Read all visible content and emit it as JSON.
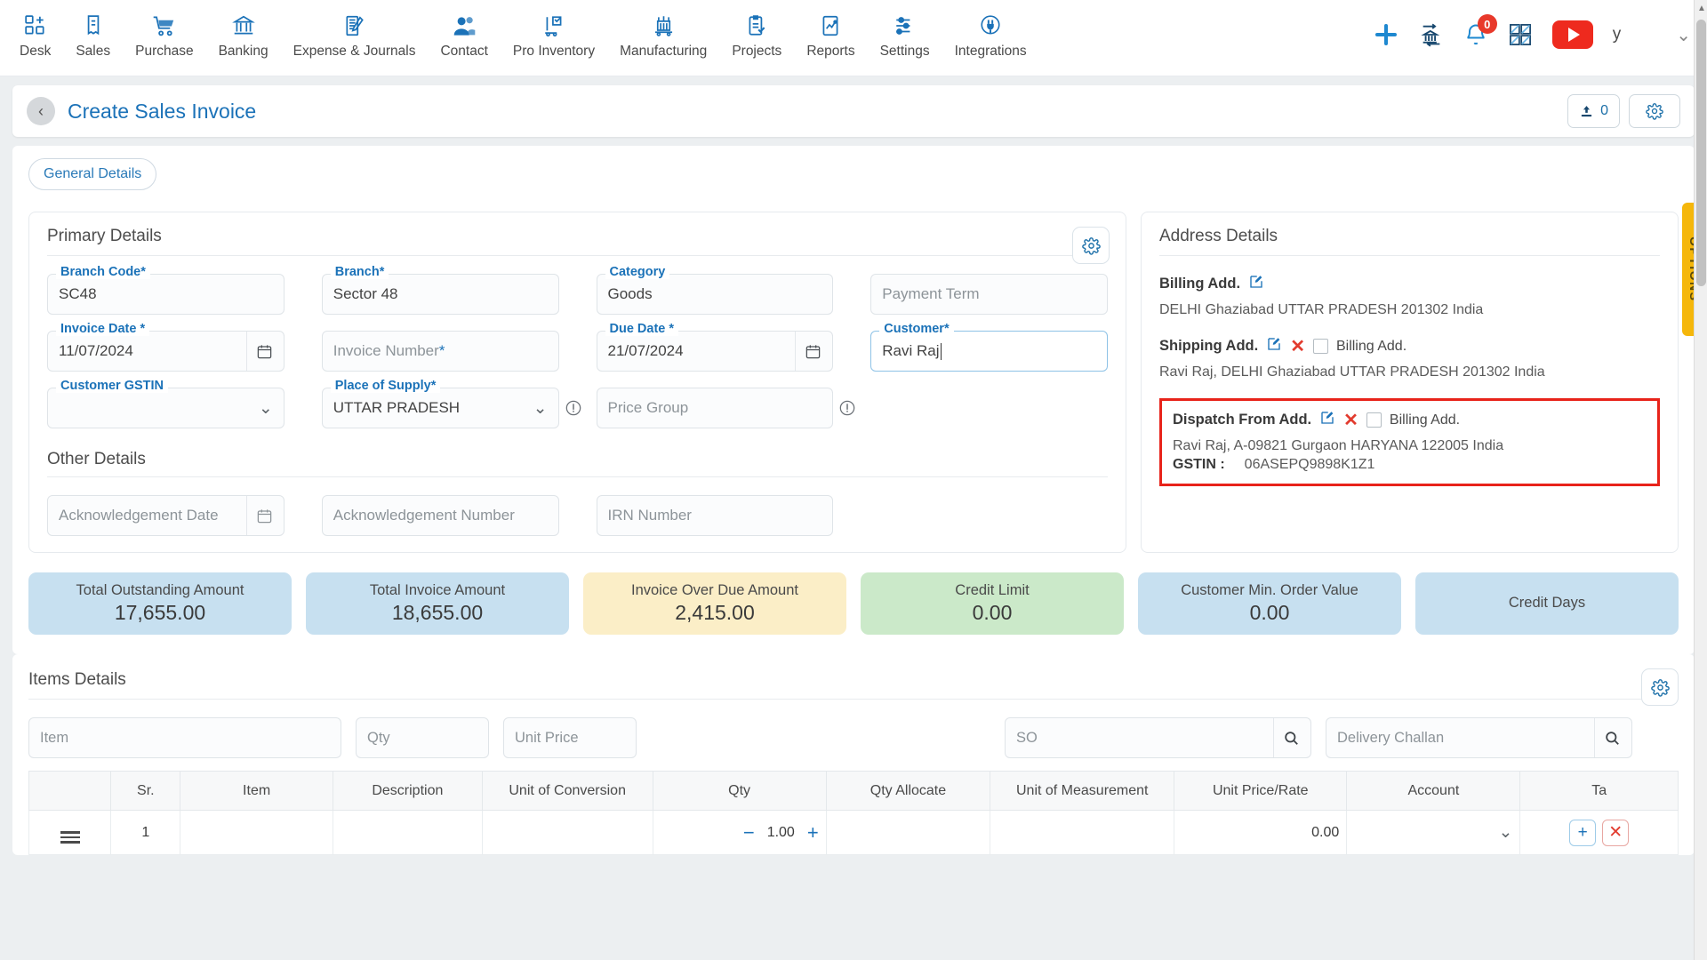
{
  "topnav": {
    "items": [
      {
        "label": "Desk",
        "icon": "desk-icon"
      },
      {
        "label": "Sales",
        "icon": "sales-icon"
      },
      {
        "label": "Purchase",
        "icon": "purchase-cart-icon"
      },
      {
        "label": "Banking",
        "icon": "bank-icon"
      },
      {
        "label": "Expense & Journals",
        "icon": "journal-icon"
      },
      {
        "label": "Contact",
        "icon": "contact-people-icon"
      },
      {
        "label": "Pro Inventory",
        "icon": "inventory-icon"
      },
      {
        "label": "Manufacturing",
        "icon": "manufacturing-icon"
      },
      {
        "label": "Projects",
        "icon": "projects-clipboard-icon"
      },
      {
        "label": "Reports",
        "icon": "reports-chart-icon"
      },
      {
        "label": "Settings",
        "icon": "settings-sliders-icon"
      },
      {
        "label": "Integrations",
        "icon": "integrations-plug-icon"
      }
    ],
    "notification_count": "0",
    "user_initial": "y"
  },
  "header": {
    "title": "Create Sales Invoice",
    "upload_count": "0"
  },
  "tabs": [
    {
      "label": "General Details"
    }
  ],
  "options_tab": {
    "label": "OPTIONS"
  },
  "primary_details": {
    "heading": "Primary Details",
    "fields": {
      "branch_code": {
        "label": "Branch Code",
        "required": true,
        "value": "SC48"
      },
      "branch": {
        "label": "Branch",
        "required": true,
        "value": "Sector 48"
      },
      "category": {
        "label": "Category",
        "required": false,
        "value": "Goods"
      },
      "payment_term": {
        "label": "",
        "placeholder": "Payment Term",
        "value": ""
      },
      "invoice_date": {
        "label": "Invoice Date *",
        "value": "11/07/2024"
      },
      "invoice_number": {
        "label": "",
        "placeholder": "Invoice Number",
        "required": true,
        "value": ""
      },
      "due_date": {
        "label": "Due Date *",
        "value": "21/07/2024"
      },
      "customer": {
        "label": "Customer",
        "required": true,
        "value": "Ravi Raj"
      },
      "customer_gstin": {
        "label": "Customer GSTIN",
        "value": ""
      },
      "place_of_supply": {
        "label": "Place of Supply",
        "required": true,
        "value": "UTTAR PRADESH"
      },
      "price_group": {
        "label": "",
        "placeholder": "Price Group",
        "value": ""
      }
    }
  },
  "other_details": {
    "heading": "Other Details",
    "fields": {
      "acknowledgement_date": {
        "placeholder": "Acknowledgement Date",
        "value": ""
      },
      "acknowledgement_number": {
        "placeholder": "Acknowledgement Number",
        "value": ""
      },
      "irn_number": {
        "placeholder": "IRN Number",
        "value": ""
      }
    }
  },
  "address_details": {
    "heading": "Address Details",
    "billing": {
      "title": "Billing Add.",
      "text": "DELHI Ghaziabad UTTAR PRADESH 201302 India"
    },
    "shipping": {
      "title": "Shipping Add.",
      "checkbox_label": "Billing Add.",
      "text": "Ravi Raj, DELHI Ghaziabad UTTAR PRADESH 201302 India"
    },
    "dispatch": {
      "title": "Dispatch From Add.",
      "checkbox_label": "Billing Add.",
      "text": "Ravi Raj, A-09821 Gurgaon HARYANA 122005 India",
      "gstin_label": "GSTIN :",
      "gstin_value": "06ASEPQ9898K1Z1",
      "highlight_color": "#e8231a"
    }
  },
  "summary_cards": [
    {
      "label": "Total Outstanding Amount",
      "value": "17,655.00",
      "color": "#c7e0f0"
    },
    {
      "label": "Total Invoice Amount",
      "value": "18,655.00",
      "color": "#c7e0f0"
    },
    {
      "label": "Invoice Over Due Amount",
      "value": "2,415.00",
      "color": "#fbeec7"
    },
    {
      "label": "Credit Limit",
      "value": "0.00",
      "color": "#cbe9c9"
    },
    {
      "label": "Customer Min. Order Value",
      "value": "0.00",
      "color": "#c7e0f0"
    },
    {
      "label": "Credit Days",
      "value": "",
      "color": "#c7e0f0"
    }
  ],
  "items_details": {
    "heading": "Items Details",
    "search": {
      "item_placeholder": "Item",
      "qty_placeholder": "Qty",
      "unit_price_placeholder": "Unit Price",
      "so_placeholder": "SO",
      "delivery_challan_placeholder": "Delivery Challan"
    },
    "columns": [
      "",
      "Sr.",
      "Item",
      "Description",
      "Unit of Conversion",
      "Qty",
      "Qty Allocate",
      "Unit of Measurement",
      "Unit Price/Rate",
      "Account",
      "Ta"
    ],
    "rows": [
      {
        "sr": "1",
        "item": "",
        "description": "",
        "unit_of_conversion": "",
        "qty": "1.00",
        "qty_allocate": "",
        "unit_of_measurement": "",
        "unit_price_rate": "0.00",
        "account": "",
        "tax": ""
      }
    ]
  }
}
